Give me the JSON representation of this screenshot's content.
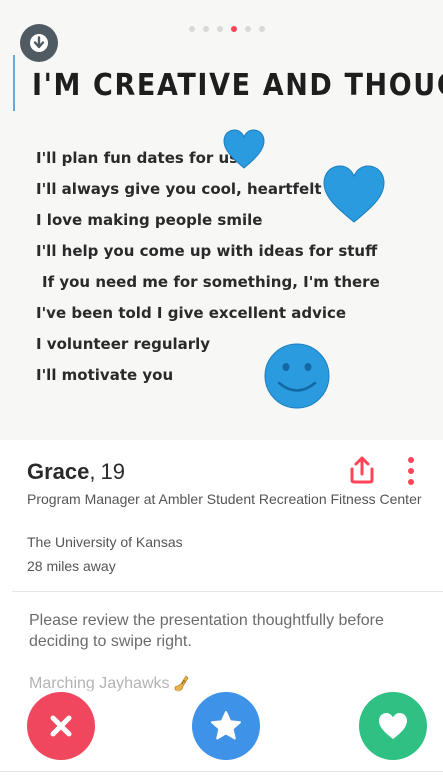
{
  "photo": {
    "dot_count": 6,
    "active_dot_index": 3,
    "title": "I'M CREATIVE AND THOUGHTFUL",
    "lines": [
      "I'll plan fun dates for us",
      "I'll always give you cool, heartfelt gifts",
      "I love making people smile",
      "I'll help you come up with ideas for stuff",
      "If you need me for something, I'm there",
      "I've been told I give excellent advice",
      "I volunteer regularly",
      "I'll motivate you"
    ],
    "decor_color": "#2b9be0"
  },
  "profile": {
    "name": "Grace",
    "separator": ",",
    "age": "19",
    "job": "Program Manager at Ambler Student Recreation Fitness Center",
    "school": "The University of Kansas",
    "distance": "28 miles away",
    "bio": "Please review the presentation thoughtfully before deciding to swipe right.",
    "anthem": "Marching Jayhawks"
  },
  "icons": {
    "download": "arrow-down-icon",
    "share": "share-icon",
    "more": "more-vertical-icon",
    "nope": "close-icon",
    "super_like": "star-icon",
    "like": "heart-icon"
  },
  "colors": {
    "accent": "#ff4458",
    "nope": "#f0475e",
    "super_like": "#3e92e8",
    "like": "#2ec183"
  }
}
